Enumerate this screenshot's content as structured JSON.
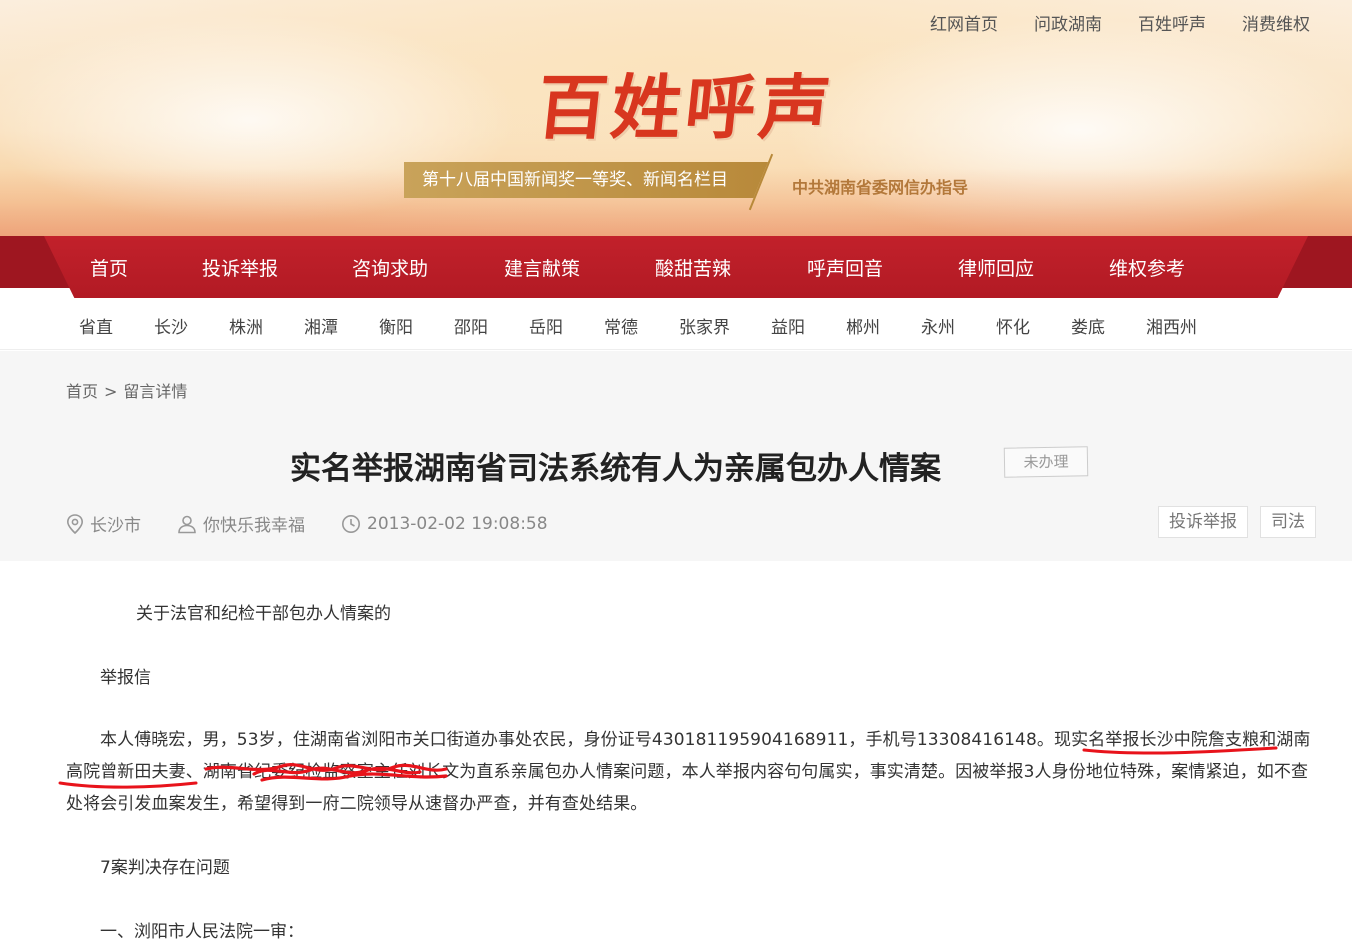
{
  "top_links": [
    "红网首页",
    "问政湖南",
    "百姓呼声",
    "消费维权"
  ],
  "banner": {
    "logo": "百姓呼声",
    "award": "第十八届中国新闻奖一等奖、新闻名栏目",
    "guide": "中共湖南省委网信办指导"
  },
  "main_nav": [
    "首页",
    "投诉举报",
    "咨询求助",
    "建言献策",
    "酸甜苦辣",
    "呼声回音",
    "律师回应",
    "维权参考"
  ],
  "city_nav": [
    "省直",
    "长沙",
    "株洲",
    "湘潭",
    "衡阳",
    "邵阳",
    "岳阳",
    "常德",
    "张家界",
    "益阳",
    "郴州",
    "永州",
    "怀化",
    "娄底",
    "湘西州"
  ],
  "breadcrumb": {
    "home": "首页",
    "sep": ">",
    "current": "留言详情"
  },
  "article": {
    "title": "实名举报湖南省司法系统有人为亲属包办人情案",
    "status": "未办理",
    "location": "长沙市",
    "author": "你快乐我幸福",
    "datetime": "2013-02-02 19:08:58",
    "tags": [
      "投诉举报",
      "司法"
    ],
    "paragraphs": {
      "subtitle": "关于法官和纪检干部包办人情案的",
      "letter": "举报信",
      "main": "本人傅晓宏，男，53岁，住湖南省浏阳市关口街道办事处农民，身份证号430181195904168911，手机号13308416148。现实名举报长沙中院詹支粮和湖南高院曾新田夫妻、湖南省纪委纪检监察室主任刘长文为直系亲属包办人情案问题，本人举报内容句句属实，事实清楚。因被举报3人身份地位特殊，案情紧迫，如不查处将会引发血案发生，希望得到一府二院领导从速督办严查，并有查处结果。",
      "cases": "7案判决存在问题",
      "first": "一、浏阳市人民法院一审："
    }
  },
  "colors": {
    "nav_red": "#b21a24",
    "logo_red": "#d8361f",
    "ribbon_gold": "#c9a35a",
    "mark_red": "#e8131b"
  }
}
